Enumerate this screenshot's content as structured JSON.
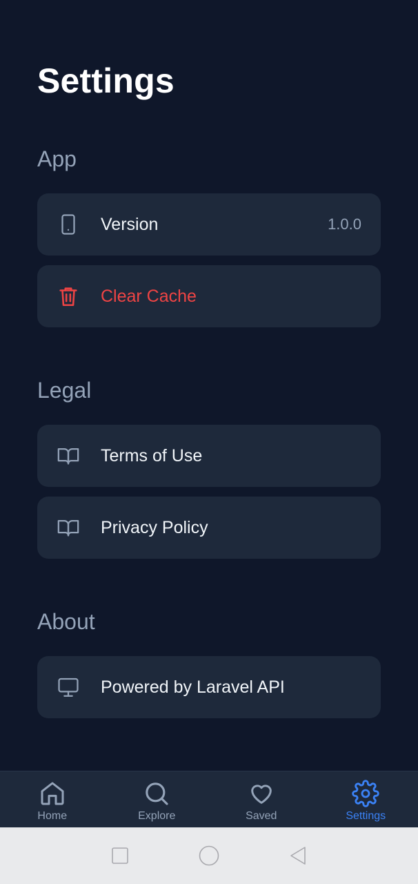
{
  "page": {
    "title": "Settings"
  },
  "sections": {
    "app": {
      "title": "App",
      "version": {
        "label": "Version",
        "value": "1.0.0",
        "icon": "tablet-icon"
      },
      "clear_cache": {
        "label": "Clear Cache",
        "icon": "trash-icon"
      }
    },
    "legal": {
      "title": "Legal",
      "terms": {
        "label": "Terms of Use",
        "icon": "book-open-icon"
      },
      "privacy": {
        "label": "Privacy Policy",
        "icon": "book-open-icon"
      }
    },
    "about": {
      "title": "About",
      "powered": {
        "label": "Powered by Laravel API",
        "icon": "monitor-icon"
      }
    }
  },
  "bottom_nav": {
    "items": [
      {
        "label": "Home",
        "icon": "home-icon"
      },
      {
        "label": "Explore",
        "icon": "search-icon"
      },
      {
        "label": "Saved",
        "icon": "heart-icon"
      },
      {
        "label": "Settings",
        "icon": "gear-icon",
        "active": true
      }
    ]
  },
  "colors": {
    "background": "#0f172a",
    "card": "#1e293b",
    "muted": "#94a3b8",
    "danger": "#ef4444",
    "accent": "#3b82f6"
  }
}
